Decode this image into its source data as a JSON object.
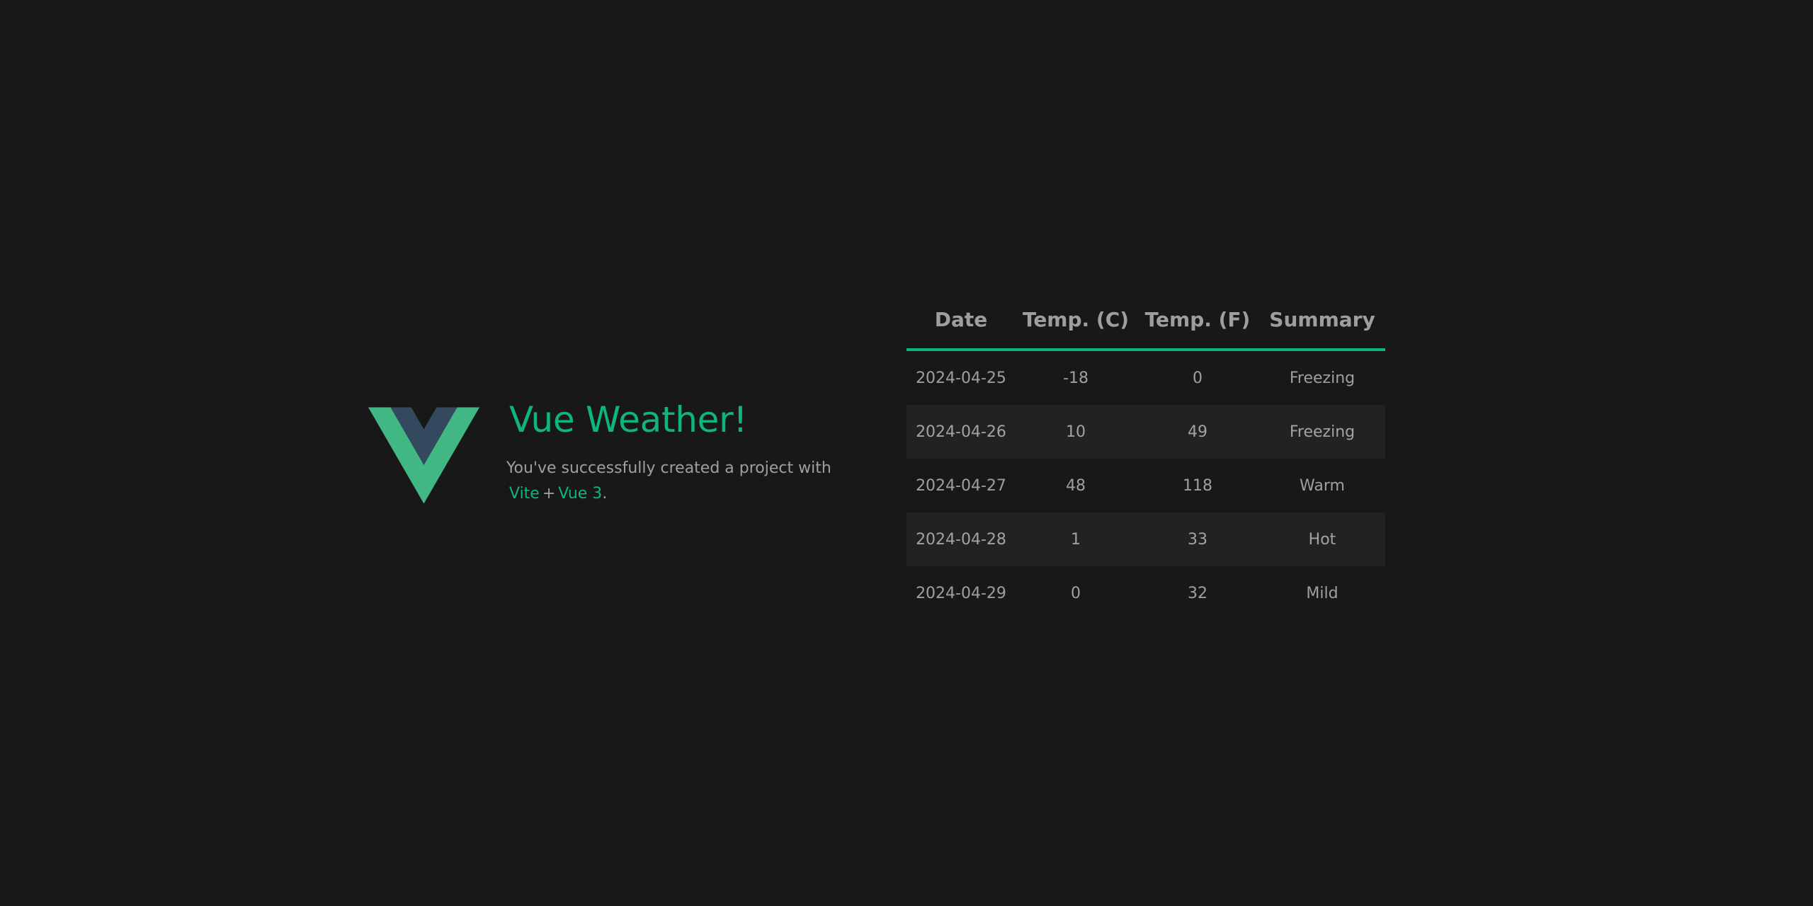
{
  "hero": {
    "title": "Vue Weather!",
    "subtitle": "You've successfully created a project with",
    "link_vite": "Vite",
    "plus": "+",
    "link_vue": "Vue 3",
    "period": "."
  },
  "logo": {
    "icon": "vue-logo-icon",
    "outer_color": "#41b883",
    "inner_color": "#34495e"
  },
  "colors": {
    "accent": "#0fb57e",
    "background": "#181818",
    "row_stripe": "#222222"
  },
  "table": {
    "headers": {
      "date": "Date",
      "temp_c": "Temp. (C)",
      "temp_f": "Temp. (F)",
      "summary": "Summary"
    },
    "rows": [
      {
        "date": "2024-04-25",
        "temp_c": "-18",
        "temp_f": "0",
        "summary": "Freezing"
      },
      {
        "date": "2024-04-26",
        "temp_c": "10",
        "temp_f": "49",
        "summary": "Freezing"
      },
      {
        "date": "2024-04-27",
        "temp_c": "48",
        "temp_f": "118",
        "summary": "Warm"
      },
      {
        "date": "2024-04-28",
        "temp_c": "1",
        "temp_f": "33",
        "summary": "Hot"
      },
      {
        "date": "2024-04-29",
        "temp_c": "0",
        "temp_f": "32",
        "summary": "Mild"
      }
    ]
  }
}
